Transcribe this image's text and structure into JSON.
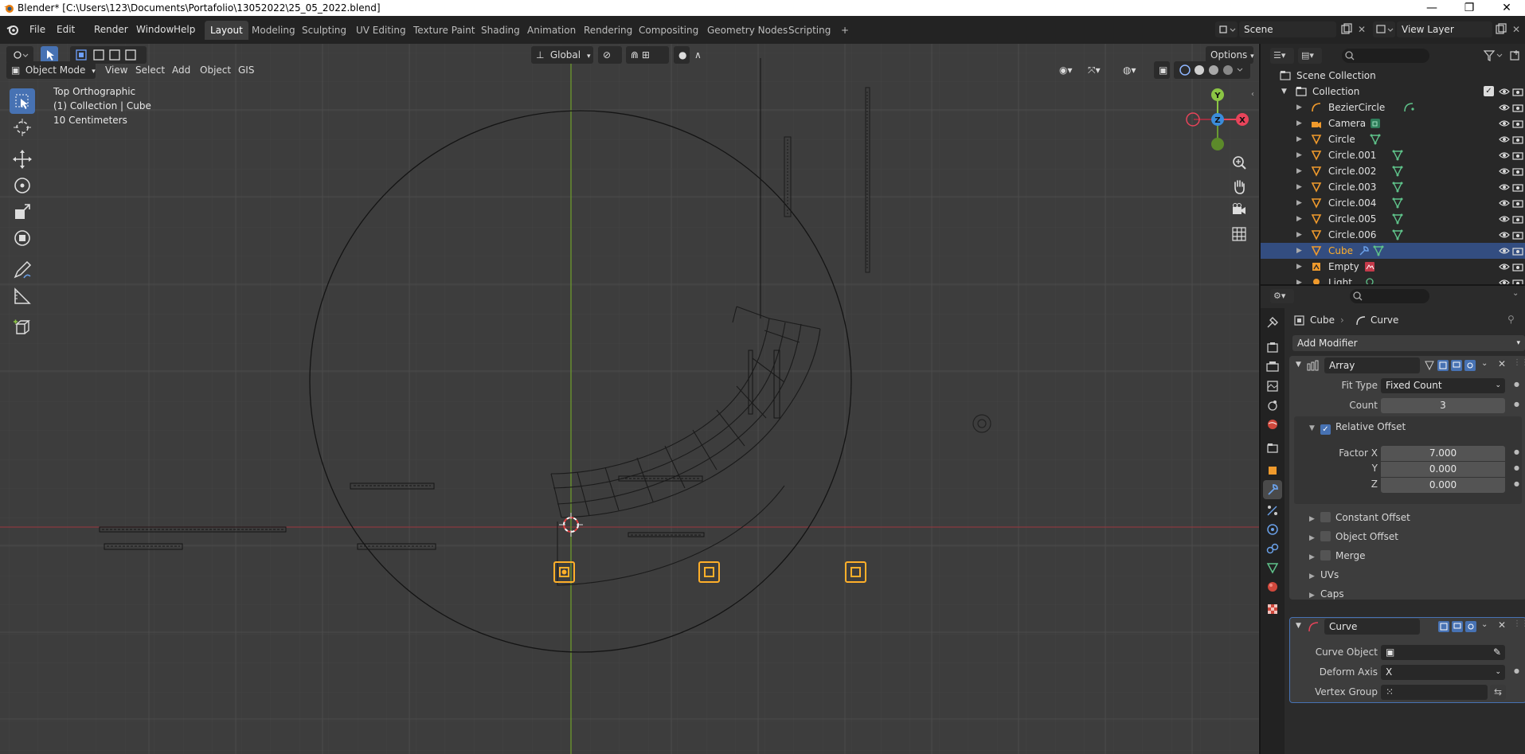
{
  "window": {
    "title": "Blender* [C:\\Users\\123\\Documents\\Portafolio\\13052022\\25_05_2022.blend]",
    "minimize": "—",
    "restore": "❐",
    "close": "✕"
  },
  "menus": [
    "File",
    "Edit",
    "Render",
    "Window",
    "Help"
  ],
  "workspaces": {
    "tabs": [
      "Layout",
      "Modeling",
      "Sculpting",
      "UV Editing",
      "Texture Paint",
      "Shading",
      "Animation",
      "Rendering",
      "Compositing",
      "Geometry Nodes",
      "Scripting"
    ],
    "active": "Layout",
    "add": "+"
  },
  "scene": {
    "name": "Scene",
    "view_layer": "View Layer"
  },
  "viewport": {
    "transform_orientation": "Global",
    "options_label": "Options",
    "mode": "Object Mode",
    "header_menus": [
      "View",
      "Select",
      "Add",
      "Object",
      "GIS"
    ],
    "overlay": {
      "view_name": "Top Orthographic",
      "collection_info": "(1) Collection | Cube",
      "scale_info": "10 Centimeters"
    },
    "gizmo_axes": {
      "x": "X",
      "y": "Y",
      "z": "Z"
    }
  },
  "outliner": {
    "search_placeholder": "",
    "root": "Scene Collection",
    "collection": "Collection",
    "items": [
      {
        "name": "BezierCircle",
        "type": "curve",
        "selected": false
      },
      {
        "name": "Camera",
        "type": "camera",
        "selected": false
      },
      {
        "name": "Circle",
        "type": "mesh",
        "selected": false
      },
      {
        "name": "Circle.001",
        "type": "mesh",
        "selected": false
      },
      {
        "name": "Circle.002",
        "type": "mesh",
        "selected": false
      },
      {
        "name": "Circle.003",
        "type": "mesh",
        "selected": false
      },
      {
        "name": "Circle.004",
        "type": "mesh",
        "selected": false
      },
      {
        "name": "Circle.005",
        "type": "mesh",
        "selected": false
      },
      {
        "name": "Circle.006",
        "type": "mesh",
        "selected": false
      },
      {
        "name": "Cube",
        "type": "mesh",
        "selected": true
      },
      {
        "name": "Empty",
        "type": "empty",
        "selected": false
      },
      {
        "name": "Light",
        "type": "light",
        "selected": false
      }
    ]
  },
  "properties": {
    "breadcrumb_object": "Cube",
    "breadcrumb_modifier": "Curve",
    "add_modifier": "Add Modifier",
    "array": {
      "name": "Array",
      "fit_type_label": "Fit Type",
      "fit_type": "Fixed Count",
      "count_label": "Count",
      "count": "3",
      "relative_offset_label": "Relative Offset",
      "relative_offset": true,
      "factor_x_label": "Factor X",
      "factor_x": "7.000",
      "y_label": "Y",
      "y": "0.000",
      "z_label": "Z",
      "z": "0.000",
      "constant_offset": "Constant Offset",
      "object_offset": "Object Offset",
      "merge": "Merge",
      "uvs": "UVs",
      "caps": "Caps"
    },
    "curve": {
      "name": "Curve",
      "curve_object_label": "Curve Object",
      "curve_object": "",
      "deform_axis_label": "Deform Axis",
      "deform_axis": "X",
      "vertex_group_label": "Vertex Group",
      "vertex_group": ""
    }
  },
  "colors": {
    "accent": "#4772b3",
    "selected_object": "#ffaf29",
    "axis_x": "#e8445a",
    "axis_y": "#8bc544",
    "axis_z": "#3b8cdb",
    "viewport_bg": "#3d3d3d"
  }
}
